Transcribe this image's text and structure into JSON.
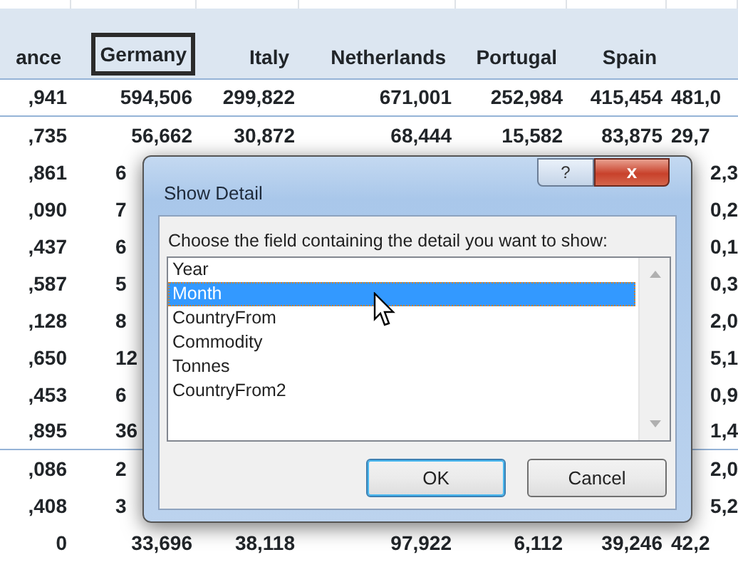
{
  "sheet": {
    "columns": [
      {
        "label": "ance",
        "selected": false
      },
      {
        "label": "Germany",
        "selected": true
      },
      {
        "label": "Italy",
        "selected": false
      },
      {
        "label": "Netherlands",
        "selected": false
      },
      {
        "label": "Portugal",
        "selected": false
      },
      {
        "label": "Spain",
        "selected": false
      }
    ],
    "rows": [
      [
        ",941",
        "594,506",
        "299,822",
        "671,001",
        "252,984",
        "415,454",
        "481,0"
      ],
      [
        ",735",
        "56,662",
        "30,872",
        "68,444",
        "15,582",
        "83,875",
        "29,7"
      ],
      [
        ",861",
        "6",
        null,
        null,
        null,
        null,
        "2,3"
      ],
      [
        ",090",
        "7",
        null,
        null,
        null,
        null,
        "0,2"
      ],
      [
        ",437",
        "6",
        null,
        null,
        null,
        null,
        "0,1"
      ],
      [
        ",587",
        "5",
        null,
        null,
        null,
        null,
        "0,3"
      ],
      [
        ",128",
        "8",
        null,
        null,
        null,
        null,
        "2,0"
      ],
      [
        ",650",
        "12",
        null,
        null,
        null,
        null,
        "5,1"
      ],
      [
        ",453",
        "6",
        null,
        null,
        null,
        null,
        "0,9"
      ],
      [
        ",895",
        "36",
        null,
        null,
        null,
        null,
        "1,4"
      ],
      [
        ",086",
        "2",
        null,
        null,
        null,
        null,
        "2,0"
      ],
      [
        ",408",
        "3",
        null,
        null,
        null,
        null,
        "5,2"
      ],
      [
        "0",
        "33,696",
        "38,118",
        "97,922",
        "6,112",
        "39,246",
        "42,2"
      ]
    ]
  },
  "dialog": {
    "title": "Show Detail",
    "help": "?",
    "close": "x",
    "prompt": "Choose the field containing the detail you want to show:",
    "items": [
      {
        "label": "Year",
        "selected": false
      },
      {
        "label": "Month",
        "selected": true
      },
      {
        "label": "CountryFrom",
        "selected": false
      },
      {
        "label": "Commodity",
        "selected": false
      },
      {
        "label": "Tonnes",
        "selected": false
      },
      {
        "label": "CountryFrom2",
        "selected": false
      }
    ],
    "buttons": [
      {
        "label": "OK",
        "kind": "default"
      },
      {
        "label": "Cancel",
        "kind": "normal"
      }
    ]
  }
}
